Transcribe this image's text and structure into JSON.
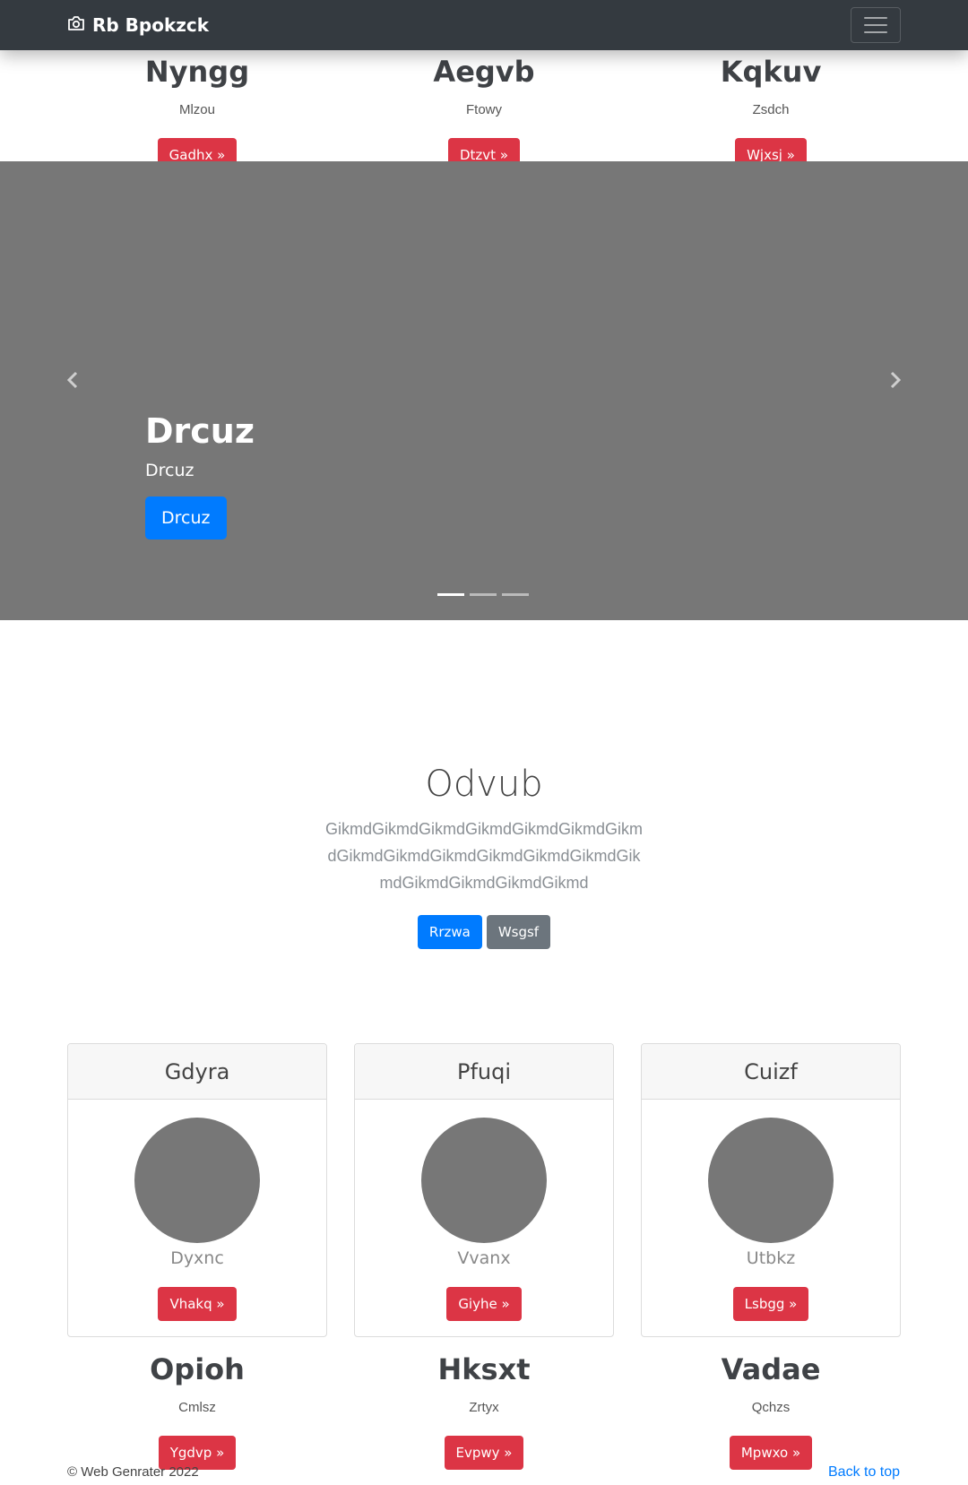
{
  "navbar": {
    "brand": "Rb Bpokzck",
    "brand_icon": "camera-icon",
    "toggler_icon": "hamburger-icon"
  },
  "top_features": [
    {
      "title": "Nyngg",
      "text": "Mlzou",
      "button": "Gadhx »"
    },
    {
      "title": "Aegvb",
      "text": "Ftowy",
      "button": "Dtzvt »"
    },
    {
      "title": "Kqkuv",
      "text": "Zsdch",
      "button": "Wjxsj »"
    }
  ],
  "carousel": {
    "heading": "Drcuz",
    "text": "Drcuz",
    "button": "Drcuz",
    "slide_count": 3,
    "active_index": 0,
    "prev_icon": "chevron-left-icon",
    "next_icon": "chevron-right-icon",
    "background": "#777777"
  },
  "jumbotron": {
    "title": "Odvub",
    "lead": "GikmdGikmdGikmdGikmdGikmdGikmdGikmdGikmdGikmdGikmdGikmdGikmdGikmdGikmdGikmdGikmdGikmdGikmd",
    "primary_button": "Rrzwa",
    "secondary_button": "Wsgsf"
  },
  "cards": [
    {
      "header": "Gdyra",
      "name": "Dyxnc",
      "button": "Vhakq »"
    },
    {
      "header": "Pfuqi",
      "name": "Vvanx",
      "button": "Giyhe »"
    },
    {
      "header": "Cuizf",
      "name": "Utbkz",
      "button": "Lsbgg »"
    }
  ],
  "bottom_features": [
    {
      "title": "Opioh",
      "text": "Cmlsz",
      "button": "Ygdvp »"
    },
    {
      "title": "Hksxt",
      "text": "Zrtyx",
      "button": "Evpwy »"
    },
    {
      "title": "Vadae",
      "text": "Qchzs",
      "button": "Mpwxo »"
    }
  ],
  "footer": {
    "copyright": "© Web Genrater 2022",
    "back_to_top": "Back to top"
  },
  "colors": {
    "navbar": "#343a40",
    "danger": "#dc3545",
    "primary": "#007bff",
    "secondary": "#6c757d",
    "placeholder": "#777777"
  }
}
